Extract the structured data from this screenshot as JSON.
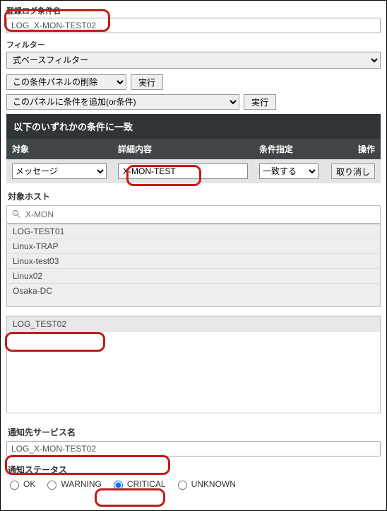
{
  "cond_name": {
    "label": "登録ログ条件名",
    "value": "LOG_X-MON-TEST02"
  },
  "filter": {
    "label": "フィルター",
    "selected": "式ベースフィルター"
  },
  "panel_ops": {
    "delete_panel": "この条件パネルの削除",
    "exec1": "実行",
    "add_condition": "このパネルに条件を追加(or条件)",
    "exec2": "実行"
  },
  "cond_table": {
    "title": "以下のいずれかの条件に一致",
    "headers": {
      "target": "対象",
      "detail": "詳細内容",
      "cond": "条件指定",
      "action": "操作"
    },
    "row": {
      "target": "メッセージ",
      "detail": "X-MON-TEST",
      "cond": "一致する",
      "cancel": "取り消し"
    }
  },
  "hosts": {
    "label": "対象ホスト",
    "search_value": "X-MON",
    "items": [
      "LOG-TEST01",
      "Linux-TRAP",
      "Linux-test03",
      "Linux02",
      "Osaka-DC"
    ],
    "selected": "LOG_TEST02"
  },
  "notify_service": {
    "label": "通知先サービス名",
    "value": "LOG_X-MON-TEST02"
  },
  "notify_status": {
    "label": "通知ステータス",
    "options": {
      "ok": "OK",
      "warning": "WARNING",
      "critical": "CRITICAL",
      "unknown": "UNKNOWN"
    },
    "checked": "critical"
  }
}
